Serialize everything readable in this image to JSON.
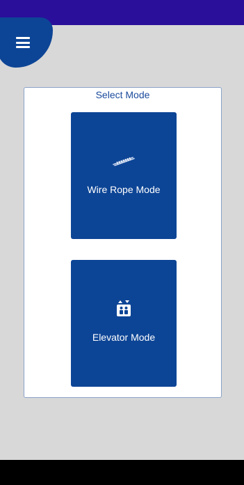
{
  "app": {
    "card_title": "Select Mode",
    "menu_icon": "hamburger-menu-icon"
  },
  "modes": [
    {
      "label": "Wire Rope Mode",
      "icon": "wire-rope-icon"
    },
    {
      "label": "Elevator Mode",
      "icon": "elevator-icon"
    }
  ],
  "colors": {
    "status_bar": "#2a0f9a",
    "primary": "#0d4596",
    "background": "#d8d8d8",
    "card": "#ffffff",
    "title_text": "#1a4a9c",
    "nav_bar": "#000000"
  }
}
